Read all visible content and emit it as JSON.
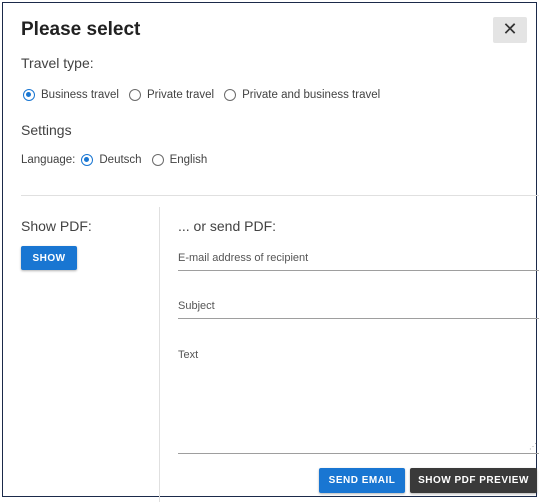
{
  "dialog": {
    "title": "Please select",
    "close_label": "✕"
  },
  "travel_type": {
    "label": "Travel type:",
    "options": [
      {
        "label": "Business travel",
        "checked": true
      },
      {
        "label": "Private travel",
        "checked": false
      },
      {
        "label": "Private and business travel",
        "checked": false
      }
    ]
  },
  "settings": {
    "label": "Settings",
    "language_label": "Language:",
    "languages": [
      {
        "label": "Deutsch",
        "checked": true
      },
      {
        "label": "English",
        "checked": false
      }
    ]
  },
  "show_pdf": {
    "label": "Show PDF:",
    "button": "SHOW"
  },
  "send_pdf": {
    "label": "... or send PDF:",
    "email_placeholder": "E-mail address of recipient",
    "subject_placeholder": "Subject",
    "text_placeholder": "Text",
    "send_button": "SEND EMAIL",
    "preview_button": "SHOW PDF PREVIEW"
  },
  "colors": {
    "accent": "#1976d2",
    "dark_button": "#3a3a3a"
  }
}
